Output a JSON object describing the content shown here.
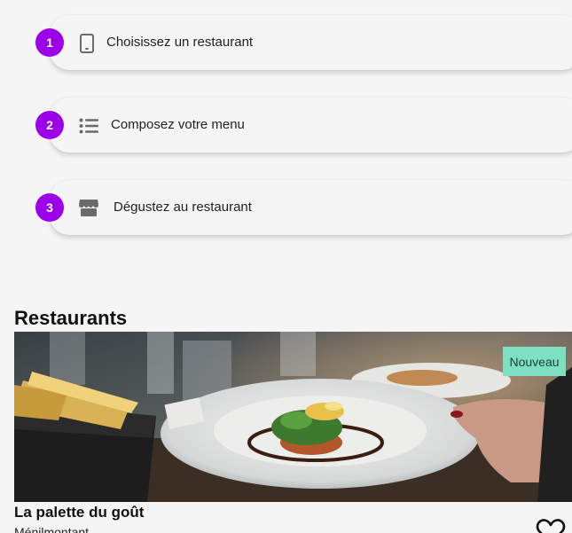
{
  "steps": [
    {
      "number": "1",
      "label": "Choisissez un restaurant",
      "icon": "smartphone-icon"
    },
    {
      "number": "2",
      "label": "Composez votre menu",
      "icon": "list-icon"
    },
    {
      "number": "3",
      "label": "Dégustez au restaurant",
      "icon": "storefront-icon"
    }
  ],
  "restaurants": {
    "title": "Restaurants",
    "items": [
      {
        "name": "La palette du goût",
        "area": "Ménilmontant",
        "badge": "Nouveau",
        "image": "plated-dish-photo",
        "favorite_icon": "heart-icon"
      }
    ]
  },
  "colors": {
    "accent": "#9b00e8",
    "badge": "#7ee0c2",
    "background": "#f5f5f5"
  }
}
